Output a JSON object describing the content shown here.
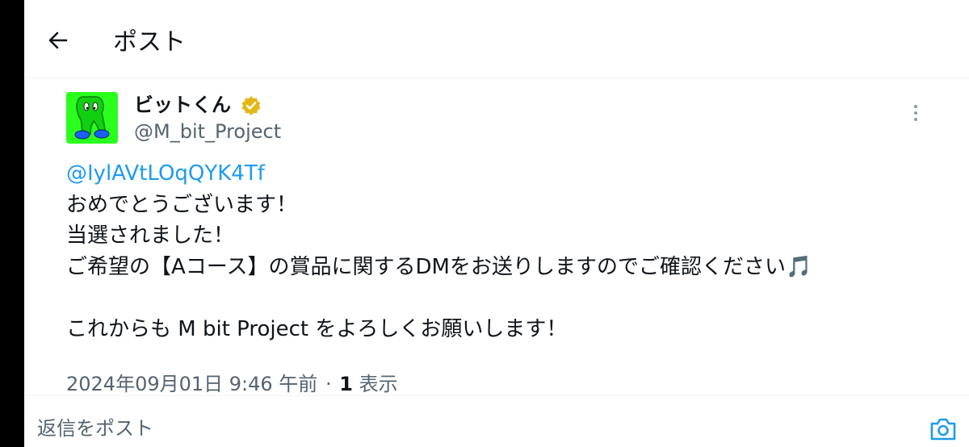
{
  "header": {
    "title": "ポスト"
  },
  "post": {
    "author_name": "ビットくん",
    "author_handle": "@M_bit_Project",
    "mention": "@IylAVtLOqQYK4Tf",
    "lines": [
      "おめでとうございます！",
      "当選されました！",
      "ご希望の【Aコース】の賞品に関するDMをお送りしますのでご確認ください🎵",
      "",
      "これからも M bit Project をよろしくお願いします！"
    ],
    "timestamp": "2024年09月01日 9:46 午前",
    "separator": "·",
    "views_count": "1",
    "views_label": "表示"
  },
  "reply": {
    "placeholder": "返信をポスト"
  },
  "colors": {
    "accent": "#1d9bf0",
    "verified_gold": "#e2b719",
    "avatar_bg": "#2aff1e",
    "secondary_text": "#536471"
  },
  "icons": {
    "back": "arrow-left-icon",
    "verified": "verified-badge-icon",
    "more": "more-vertical-icon",
    "camera": "camera-icon"
  }
}
